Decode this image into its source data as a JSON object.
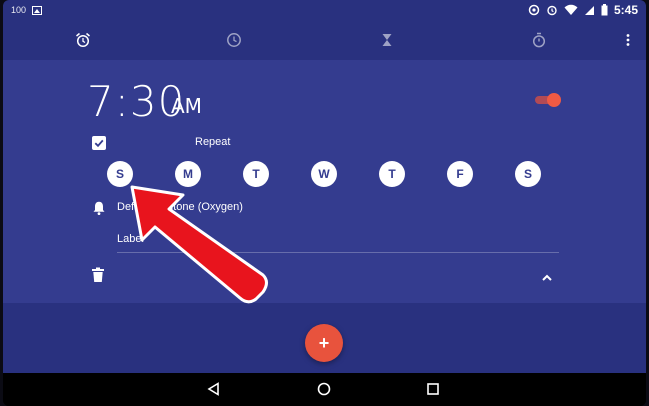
{
  "statusbar": {
    "battery_text": "100",
    "time": "5:45"
  },
  "tabs": [
    {
      "name": "alarm",
      "icon": "alarm-clock-icon"
    },
    {
      "name": "clock",
      "icon": "clock-icon"
    },
    {
      "name": "timer",
      "icon": "hourglass-icon"
    },
    {
      "name": "stopwatch",
      "icon": "stopwatch-icon"
    }
  ],
  "alarm": {
    "time": "7:30",
    "ampm": "AM",
    "enabled": true,
    "repeat_checked": true,
    "repeat_label": "Repeat",
    "days": [
      "S",
      "M",
      "T",
      "W",
      "T",
      "F",
      "S"
    ],
    "ringtone": "Default ringtone (Oxygen)",
    "label": "Label"
  },
  "fab": {
    "label": "+"
  },
  "colors": {
    "header": "#29317f",
    "panel": "#343c8f",
    "accent": "#e8533d",
    "arrow": "#e8141d"
  }
}
